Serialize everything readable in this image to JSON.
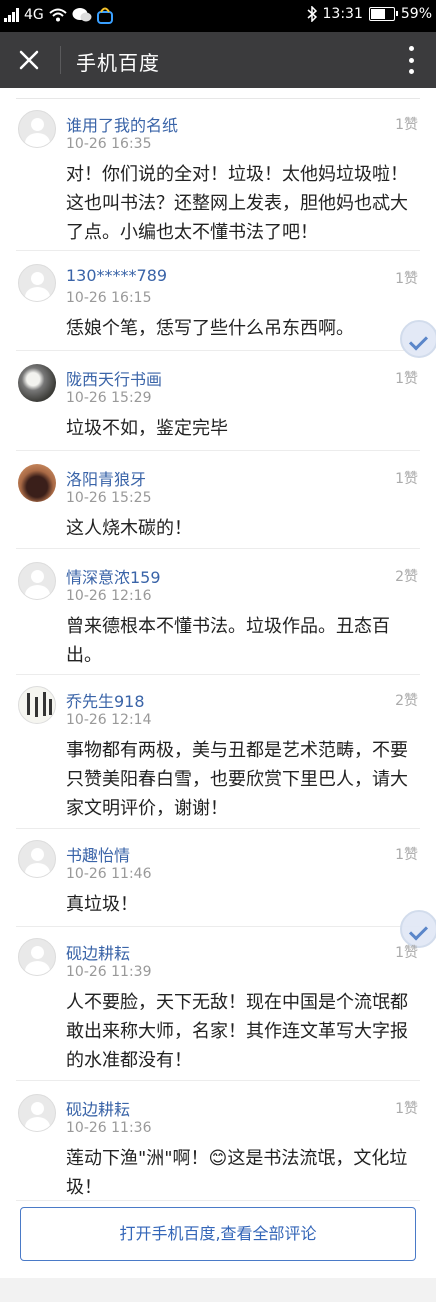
{
  "status_bar": {
    "network": "4G",
    "time": "13:31",
    "battery": "59%"
  },
  "title_bar": {
    "title": "手机百度"
  },
  "comments": [
    {
      "name": "谁用了我的名纸",
      "time": "10-26 16:35",
      "likes": "1赞",
      "text": "对！你们说的全对！垃圾！太他妈垃圾啦！这也叫书法？还整网上发表，胆他妈也忒大了点。小编也太不懂书法了吧！",
      "avatar": "default"
    },
    {
      "name": "130*****789",
      "time": "10-26 16:15",
      "likes": "1赞",
      "text": "恁娘个笔，恁写了些什么吊东西啊。",
      "avatar": "default"
    },
    {
      "name": "陇西天行书画",
      "time": "10-26 15:29",
      "likes": "1赞",
      "text": "垃圾不如，鉴定完毕",
      "avatar": "photo1"
    },
    {
      "name": "洛阳青狼牙",
      "time": "10-26 15:25",
      "likes": "1赞",
      "text": "这人烧木碳的！",
      "avatar": "photo2"
    },
    {
      "name": "情深意浓159",
      "time": "10-26 12:16",
      "likes": "2赞",
      "text": "曾来德根本不懂书法。垃圾作品。丑态百出。",
      "avatar": "default"
    },
    {
      "name": "乔先生918",
      "time": "10-26 12:14",
      "likes": "2赞",
      "text": "事物都有两极，美与丑都是艺术范畴，不要只赞美阳春白雪，也要欣赏下里巴人，请大家文明评价，谢谢！",
      "avatar": "photo3"
    },
    {
      "name": "书趣怡情",
      "time": "10-26 11:46",
      "likes": "1赞",
      "text": "真垃圾！",
      "avatar": "default"
    },
    {
      "name": "砚边耕耘",
      "time": "10-26 11:39",
      "likes": "1赞",
      "text": "人不要脸，天下无敌！现在中国是个流氓都敢出来称大师，名家！其作连文革写大字报的水准都没有！",
      "avatar": "default"
    },
    {
      "name": "砚边耕耘",
      "time": "10-26 11:36",
      "likes": "1赞",
      "text": "莲动下渔\"洲\"啊！😊这是书法流氓，文化垃圾！",
      "avatar": "default"
    }
  ],
  "open_button": {
    "label": "打开手机百度,查看全部评论"
  }
}
